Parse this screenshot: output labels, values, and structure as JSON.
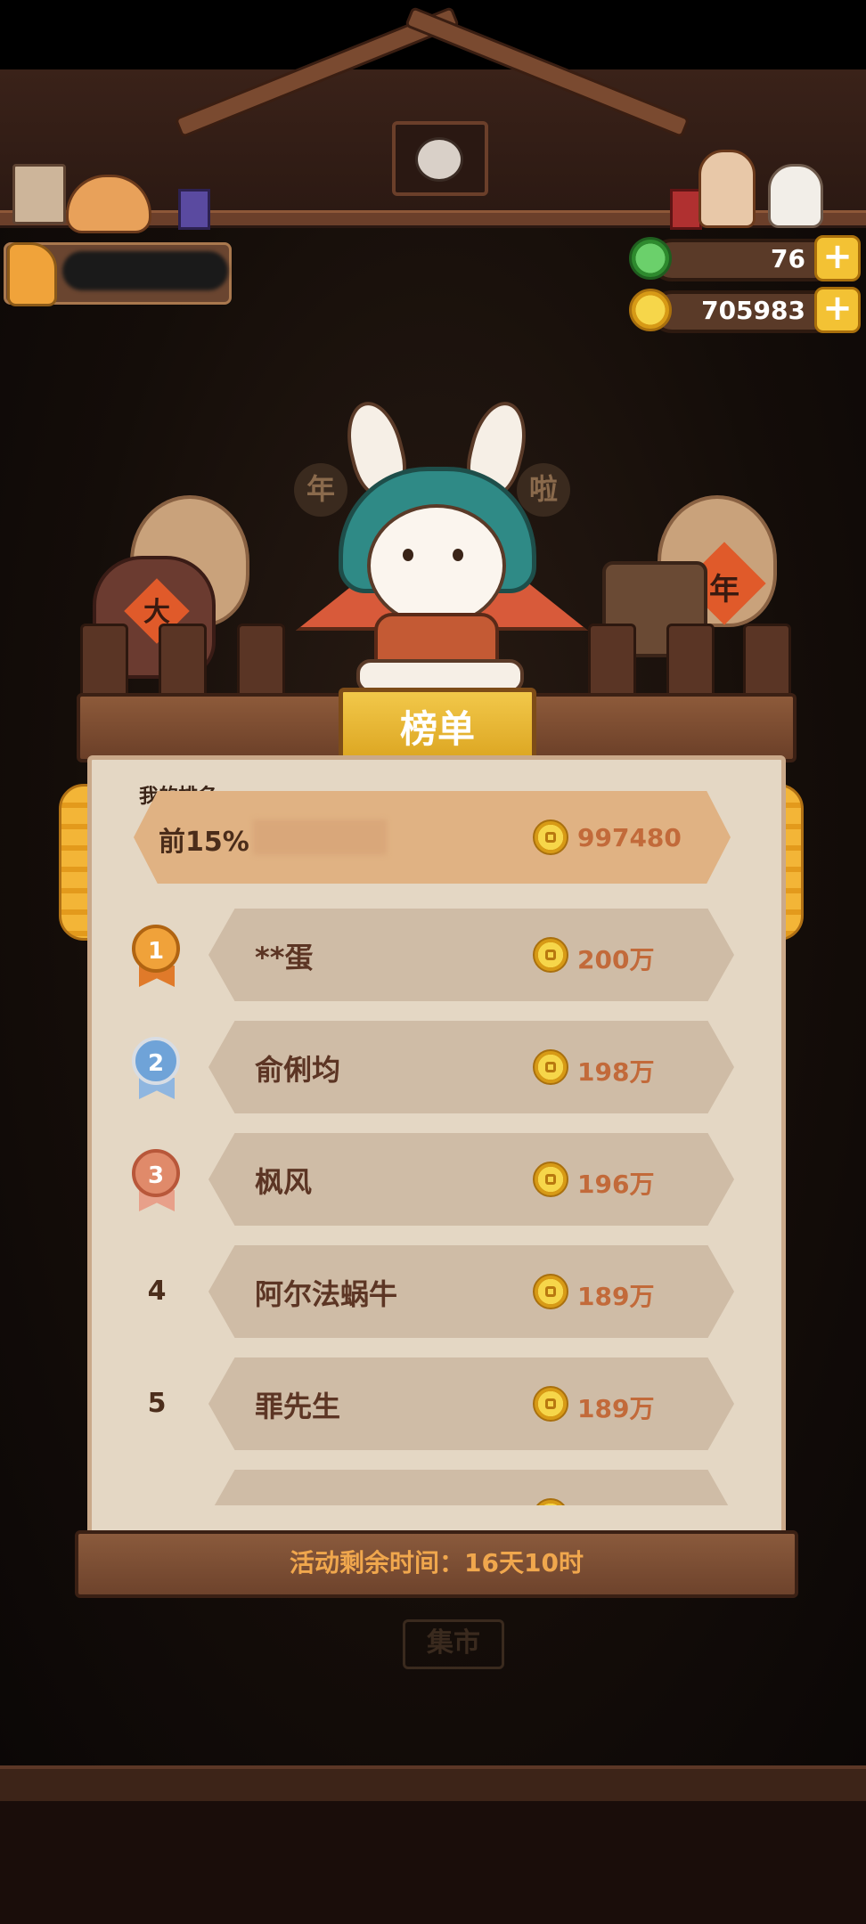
{
  "resources": {
    "gems": "76",
    "coins": "705983"
  },
  "panel": {
    "title": "榜单",
    "my_rank_label": "我的排名",
    "my_rank": {
      "rank": "前15%",
      "score": "997480"
    },
    "rows": [
      {
        "rank": "1",
        "name": "**蛋",
        "score": "200万"
      },
      {
        "rank": "2",
        "name": "俞俐均",
        "score": "198万"
      },
      {
        "rank": "3",
        "name": "枫风",
        "score": "196万"
      },
      {
        "rank": "4",
        "name": "阿尔法蜗牛",
        "score": "189万"
      },
      {
        "rank": "5",
        "name": "罪先生",
        "score": "189万"
      }
    ],
    "footer": "活动剩余时间：16天10时"
  },
  "background_signs": {
    "left_jar": "大",
    "right_jar": "年",
    "left_bubble": "年",
    "right_bubble": "啦",
    "bottom_sign": "集市"
  },
  "colors": {
    "accent": "#f3c234",
    "panel_bg": "#e4d7c4",
    "score": "#c26a3a",
    "gold_medal": "#f0a23a",
    "silver_medal": "#6fa3d8",
    "bronze_medal": "#e08a6a"
  }
}
